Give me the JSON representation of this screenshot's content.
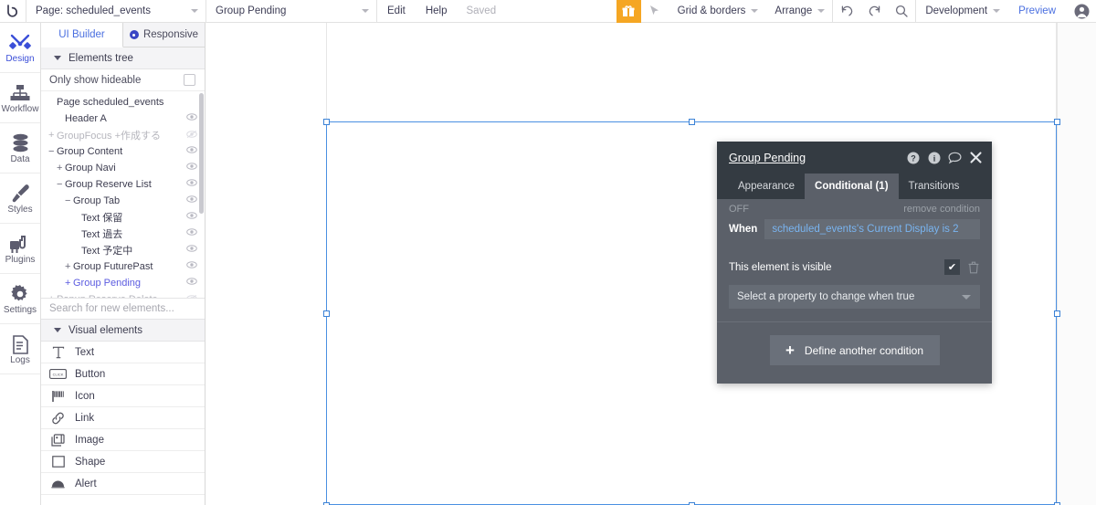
{
  "topbar": {
    "logo": "bubble-logo-icon",
    "page_selector": "Page: scheduled_events",
    "element_selector": "Group Pending",
    "edit": "Edit",
    "help": "Help",
    "saved": "Saved",
    "gift": "gift-icon",
    "pointer": "pointer-icon",
    "grid_borders": "Grid & borders",
    "arrange": "Arrange",
    "undo": "undo-icon",
    "redo": "redo-icon",
    "search": "search-icon",
    "version": "Development",
    "preview": "Preview",
    "avatar": "user-avatar-icon"
  },
  "rail": {
    "items": [
      {
        "label": "Design",
        "icon": "design-icon",
        "active": true
      },
      {
        "label": "Workflow",
        "icon": "workflow-icon",
        "active": false
      },
      {
        "label": "Data",
        "icon": "database-icon",
        "active": false
      },
      {
        "label": "Styles",
        "icon": "paintbrush-icon",
        "active": false
      },
      {
        "label": "Plugins",
        "icon": "plugins-icon",
        "active": false
      },
      {
        "label": "Settings",
        "icon": "gear-icon",
        "active": false
      },
      {
        "label": "Logs",
        "icon": "document-icon",
        "active": false
      }
    ]
  },
  "panel": {
    "tabs": [
      {
        "label": "UI Builder",
        "active": true
      },
      {
        "label": "Responsive",
        "active": false
      }
    ],
    "elements_tree_header": "Elements tree",
    "only_show_hideable": "Only show hideable",
    "only_show_hideable_checked": false,
    "tree": [
      {
        "sign": "",
        "label": "Page scheduled_events",
        "indent": 0,
        "state": "normal",
        "eye": "none"
      },
      {
        "sign": "",
        "label": "Header A",
        "indent": 1,
        "state": "normal",
        "eye": "visible"
      },
      {
        "sign": "+",
        "label": "GroupFocus +作成する",
        "indent": 0,
        "state": "dim",
        "eye": "hidden"
      },
      {
        "sign": "−",
        "label": "Group Content",
        "indent": 0,
        "state": "normal",
        "eye": "visible"
      },
      {
        "sign": "+",
        "label": "Group Navi",
        "indent": 1,
        "state": "normal",
        "eye": "visible"
      },
      {
        "sign": "−",
        "label": "Group Reserve List",
        "indent": 1,
        "state": "normal",
        "eye": "visible"
      },
      {
        "sign": "−",
        "label": "Group Tab",
        "indent": 2,
        "state": "normal",
        "eye": "visible"
      },
      {
        "sign": "",
        "label": "Text 保留",
        "indent": 3,
        "state": "normal",
        "eye": "visible"
      },
      {
        "sign": "",
        "label": "Text 過去",
        "indent": 3,
        "state": "normal",
        "eye": "visible"
      },
      {
        "sign": "",
        "label": "Text 予定中",
        "indent": 3,
        "state": "normal",
        "eye": "visible"
      },
      {
        "sign": "+",
        "label": "Group FuturePast",
        "indent": 2,
        "state": "normal",
        "eye": "visible"
      },
      {
        "sign": "+",
        "label": "Group Pending",
        "indent": 2,
        "state": "selected",
        "eye": "visible"
      },
      {
        "sign": "+",
        "label": "Popup Reserve Delete",
        "indent": 0,
        "state": "dim",
        "eye": "hidden"
      }
    ],
    "search_placeholder": "Search for new elements...",
    "visual_elements_header": "Visual elements",
    "visual_elements": [
      {
        "label": "Text",
        "icon": "text-icon"
      },
      {
        "label": "Button",
        "icon": "button-icon"
      },
      {
        "label": "Icon",
        "icon": "flag-icon"
      },
      {
        "label": "Link",
        "icon": "link-icon"
      },
      {
        "label": "Image",
        "icon": "image-icon"
      },
      {
        "label": "Shape",
        "icon": "shape-icon"
      },
      {
        "label": "Alert",
        "icon": "alert-icon"
      }
    ],
    "collapse": "collapse-panel-arrow-icon"
  },
  "properties": {
    "title": "Group Pending",
    "header_icons": [
      "help-icon",
      "info-icon",
      "comment-icon",
      "close-icon"
    ],
    "tabs": [
      {
        "label": "Appearance",
        "active": false
      },
      {
        "label": "Conditional (1)",
        "active": true
      },
      {
        "label": "Transitions",
        "active": false
      }
    ],
    "condition_state": "OFF",
    "remove_condition": "remove condition",
    "when_label": "When",
    "when_expression": "scheduled_events's Current Display is 2",
    "visible_label": "This element is visible",
    "visible_checked": true,
    "delete": "trash-icon",
    "select_property": "Select a property to change when true",
    "define_another": "Define another condition"
  },
  "colors": {
    "accent_blue": "#4a6fe0",
    "selection_blue": "#4a90e2",
    "gift_orange": "#f5a623",
    "popup_bg": "#5b6069",
    "popup_header": "#343b42",
    "expression_blue": "#79b4f0"
  }
}
